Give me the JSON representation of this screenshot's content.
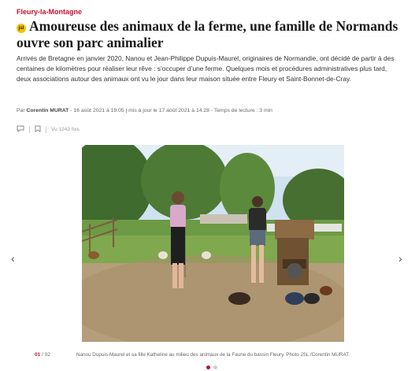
{
  "article": {
    "category": "Fleury-la-Montagne",
    "badge": "jsl",
    "headline": "Amoureuse des animaux de la ferme, une famille de Normands ouvre son parc animalier",
    "chapo": "Arrivés de Bretagne en janvier 2020, Nanou et Jean-Philippe Dupuis-Maurel, originaires de Normandie, ont décidé de partir à des centaines de kilomètres pour réaliser leur rêve : s’occuper d’une ferme. Quelques mois et procédures administratives plus tard, deux associations autour des animaux ont vu le jour dans leur maison située entre Fleury et Saint-Bonnet-de-Cray.",
    "meta_prefix": "Par",
    "author": "Corentin MURAT",
    "meta_rest": "- 16 août 2021 à 19:05 | mis à jour le 17 août 2021 à 14:28 - Temps de lecture : 3 min",
    "views": "Vu 1243 fois"
  },
  "gallery": {
    "current": "01",
    "total": "02",
    "caption": "Nanou Dupuis-Maurel et sa fille Katheline au milieu des animaux de la Faune du bassin Fleury.  Photo JSL /Corentin MURAT.",
    "prev_icon": "chevron-left-icon",
    "next_icon": "chevron-right-icon"
  },
  "colors": {
    "accent": "#c8102e",
    "badge": "#f2c300"
  }
}
